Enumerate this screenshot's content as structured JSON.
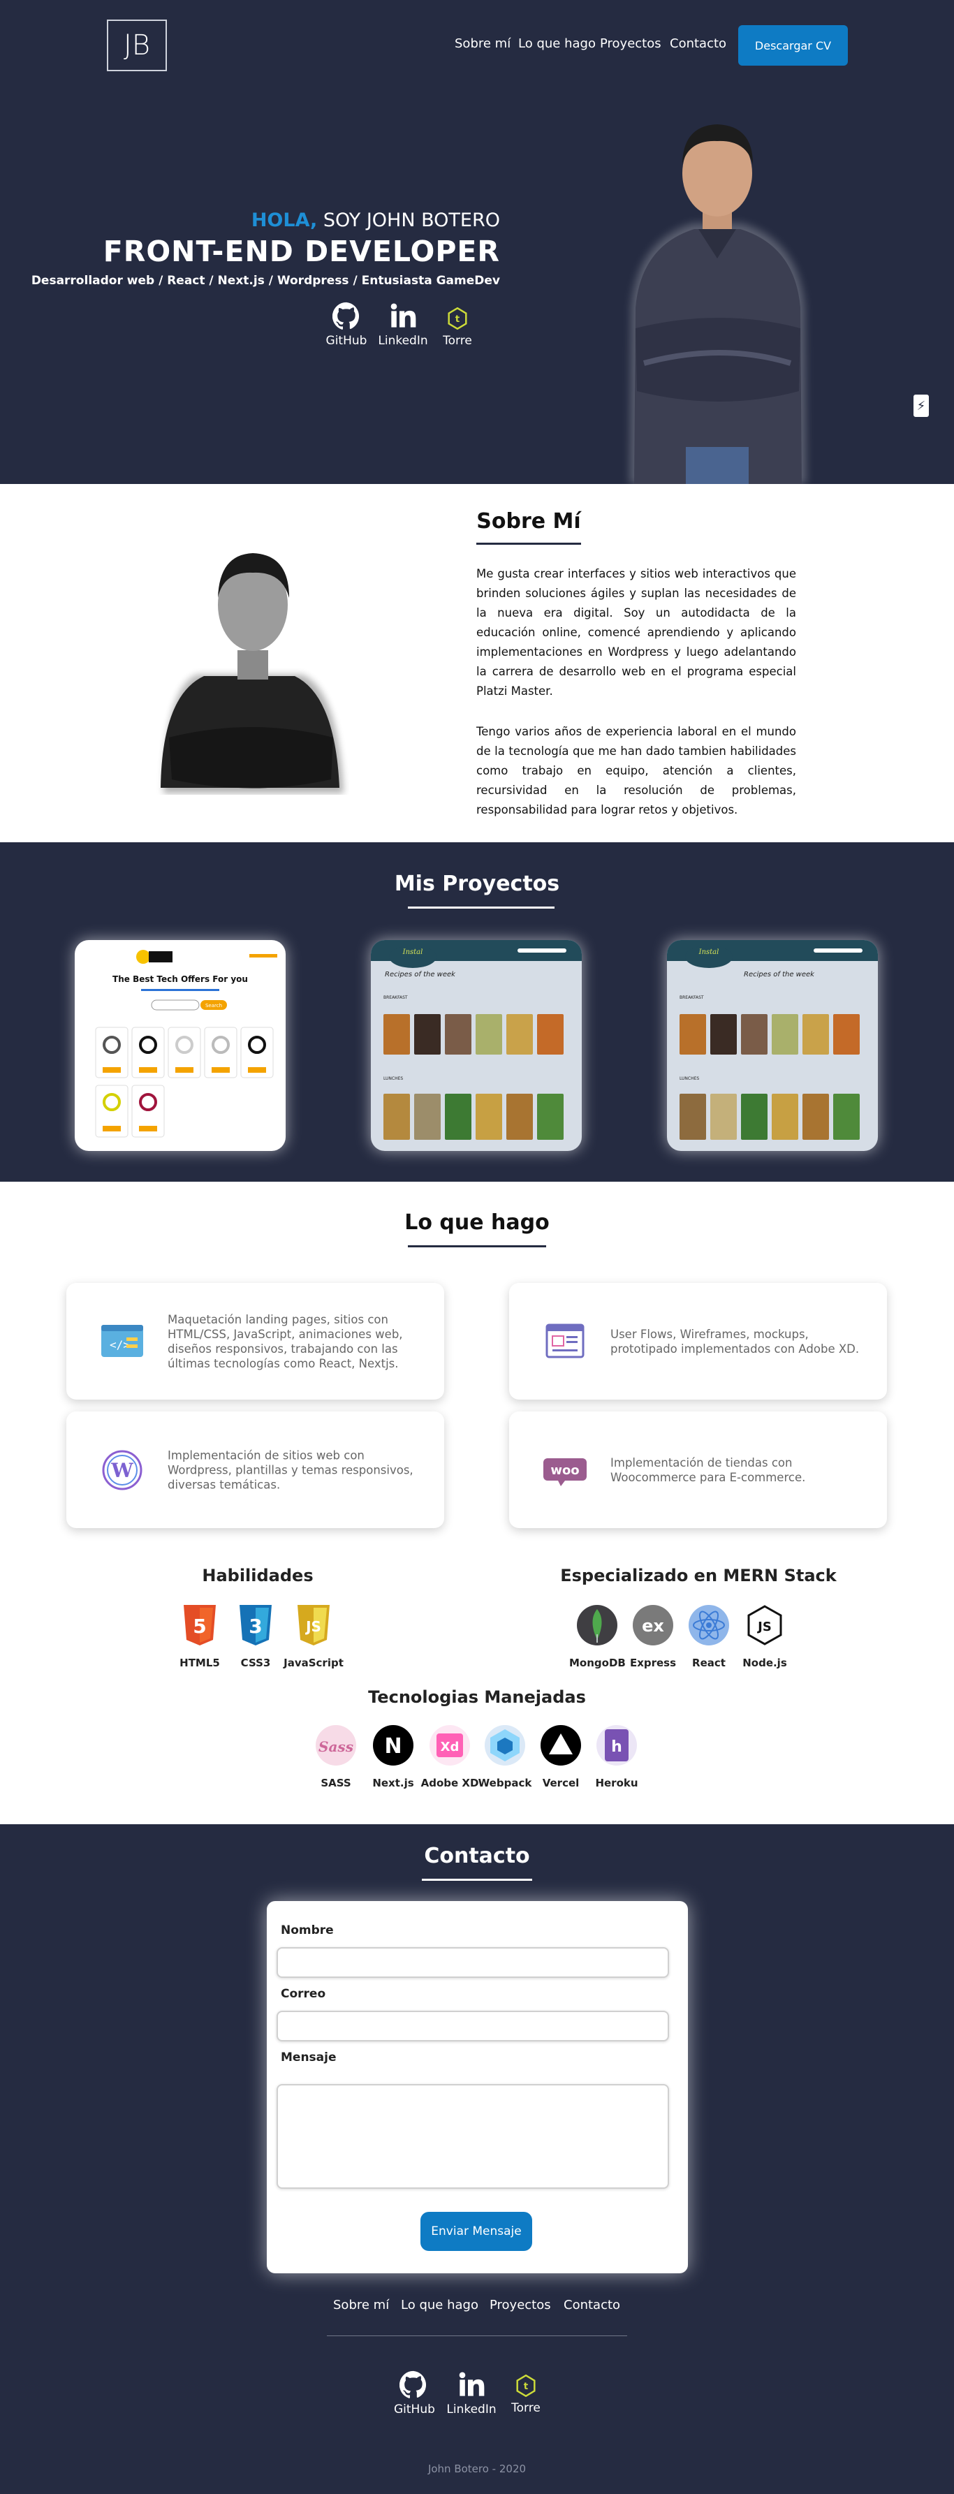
{
  "header": {
    "logo": "JB",
    "nav": [
      "Sobre mí",
      "Lo que hago",
      "Proyectos",
      "Contacto"
    ],
    "cv_button": "Descargar CV"
  },
  "hero": {
    "greeting": "HOLA,",
    "intro": "SOY JOHN BOTERO",
    "role": "FRONT-END DEVELOPER",
    "subtitle": "Desarrollador web / React / Next.js / Wordpress / Entusiasta GameDev",
    "social": [
      "GitHub",
      "LinkedIn",
      "Torre"
    ],
    "bolt_icon": "⚡"
  },
  "about": {
    "title": "Sobre Mí",
    "p1": "Me gusta crear interfaces y sitios web interactivos que brinden soluciones ágiles y suplan las necesidades de la nueva era digital. Soy un autodidacta de la educación online, comencé aprendiendo y aplicando implementaciones en Wordpress y luego adelantando la carrera de desarrollo web en el programa especial Platzi Master.",
    "p2": "Tengo varios años de experiencia laboral en el mundo de la tecnología que me han dado tambien habilidades como trabajo en equipo, atención a clientes, recursividad en la resolución de problemas, responsabilidad para lograr retos y objetivos."
  },
  "projects": {
    "title": "Mis Proyectos",
    "p1": {
      "heading": "The Best Tech Offers For you",
      "search_btn": "Search",
      "badge": "$99.99"
    },
    "p2": {
      "heading": "Recipes of the week",
      "breakfast": "BREAKFAST",
      "lunches": "LUNCHES"
    }
  },
  "services": {
    "title": "Lo que hago",
    "items": [
      "Maquetación landing pages, sitios con HTML/CSS, JavaScript, animaciones web, diseños responsivos, trabajando con las últimas tecnologías como React, Nextjs.",
      "User Flows, Wireframes, mockups, prototipado implementados con Adobe XD.",
      "Implementación de sitios web con Wordpress, plantillas y temas responsivos, diversas temáticas.",
      "Implementación de tiendas con Woocommerce para E-commerce."
    ]
  },
  "skills": {
    "habilidades_title": "Habilidades",
    "habilidades": [
      "HTML5",
      "CSS3",
      "JavaScript"
    ],
    "mern_title": "Especializado en MERN Stack",
    "mern": [
      "MongoDB",
      "Express",
      "React",
      "Node.js"
    ],
    "tech_title": "Tecnologias Manejadas",
    "tech": [
      "SASS",
      "Next.js",
      "Adobe XD",
      "Webpack",
      "Vercel",
      "Heroku"
    ]
  },
  "contact": {
    "title": "Contacto",
    "name_label": "Nombre",
    "email_label": "Correo",
    "message_label": "Mensaje",
    "send_button": "Enviar Mensaje"
  },
  "footer": {
    "nav": [
      "Sobre mí",
      "Lo que hago",
      "Proyectos",
      "Contacto"
    ],
    "social": [
      "GitHub",
      "LinkedIn",
      "Torre"
    ],
    "copyright": "John Botero - 2020"
  },
  "colors": {
    "dark_bg": "#252b41",
    "accent": "#0e7bc4",
    "highlight": "#1e8fd6"
  }
}
